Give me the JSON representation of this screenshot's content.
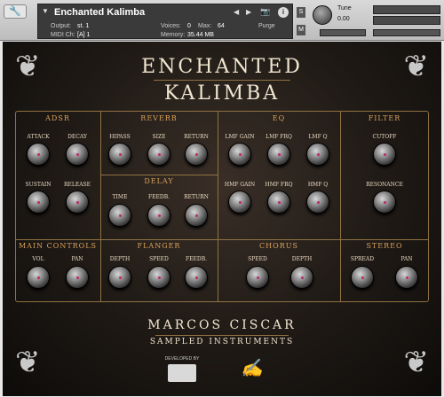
{
  "header": {
    "wrench": "🔧",
    "title": "Enchanted Kalimba",
    "output_label": "Output:",
    "output_value": "st. 1",
    "voices_label": "Voices:",
    "voices_value": "0",
    "max_label": "Max:",
    "max_value": "64",
    "midi_label": "MIDI Ch:",
    "midi_value": "[A] 1",
    "memory_label": "Memory:",
    "memory_value": "35.44 MB",
    "purge_label": "Purge",
    "s_label": "S",
    "m_label": "M",
    "tune_label": "Tune",
    "tune_value": "0.00",
    "aux_label": "aux",
    "pv_label": "pv"
  },
  "product": {
    "line1": "ENCHANTED",
    "line2": "KALIMBA"
  },
  "sections": {
    "adsr": "ADSR",
    "reverb": "REVERB",
    "eq": "EQ",
    "filter": "FILTER",
    "delay": "DELAY",
    "main": "MAIN CONTROLS",
    "flanger": "FLANGER",
    "chorus": "CHORUS",
    "stereo": "STEREO"
  },
  "knobs": {
    "attack": "ATTACK",
    "decay": "DECAY",
    "sustain": "SUSTAIN",
    "release": "RELEASE",
    "hipass": "HIPASS",
    "size": "SIZE",
    "return": "RETURN",
    "time": "TIME",
    "feedb": "FEEDB.",
    "depth": "DEPTH",
    "speed": "SPEED",
    "vol": "VOL",
    "pan": "PAN",
    "lmf_gain": "LMF GAIN",
    "lmf_frq": "LMF FRQ",
    "lmf_q": "LMF Q",
    "hmf_gain": "HMF GAIN",
    "hmf_frq": "HMF FRQ",
    "hmf_q": "HMF Q",
    "cutoff": "CUTOFF",
    "resonance": "RESONANCE",
    "spread": "SPREAD"
  },
  "footer": {
    "brand": "MARCOS CISCAR",
    "sub": "SAMPLED INSTRUMENTS",
    "dev": "DEVELOPED BY"
  }
}
